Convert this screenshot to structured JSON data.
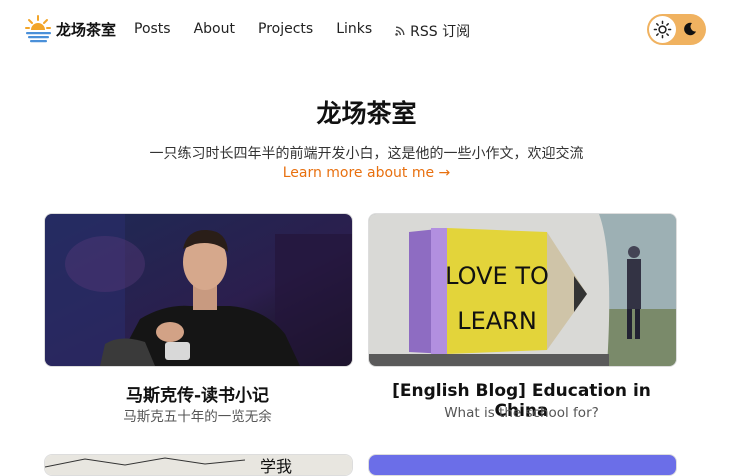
{
  "nav": {
    "logo_text": "龙场茶室",
    "links": [
      "Posts",
      "About",
      "Projects",
      "Links"
    ],
    "rss_label": "RSS 订阅",
    "theme_toggle": {
      "light_icon": "sun-icon",
      "dark_icon": "moon-icon",
      "accent": "#f0b260"
    }
  },
  "hero": {
    "title": "龙场茶室",
    "subtitle": "一只练习时长四年半的前端开发小白，这是他的一些小作文，欢迎交流",
    "link_text": "Learn more about me →",
    "link_color": "#e8700f"
  },
  "cards": [
    {
      "title": "马斯克传-读书小记",
      "desc": "马斯克五十年的一览无余"
    },
    {
      "title": "[English Blog] Education in China",
      "desc": "What is the school for?"
    }
  ],
  "sign": {
    "line1": "LOVE TO",
    "line2": "LEARN"
  },
  "partial_card_text": "学我"
}
